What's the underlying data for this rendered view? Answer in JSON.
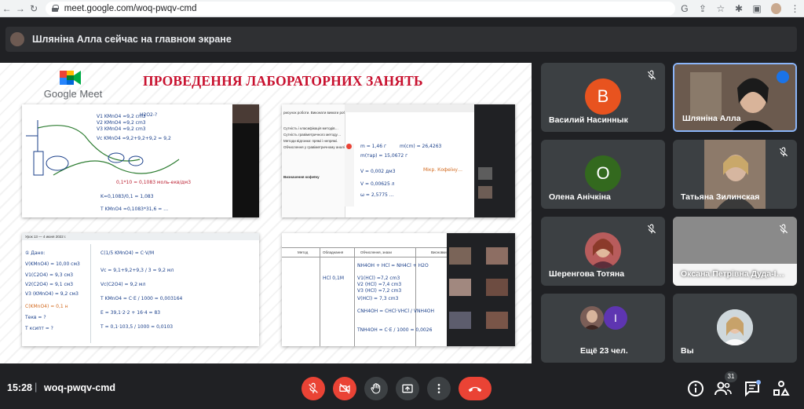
{
  "browser": {
    "url": "meet.google.com/woq-pwqv-cmd"
  },
  "banner": {
    "text": "Шляніна Алла сейчас на главном экране"
  },
  "slide": {
    "logo_text": "Google Meet",
    "title": "ПРОВЕДЕННЯ ЛАБОРАТОРНИХ ЗАНЯТЬ"
  },
  "participants": [
    {
      "name": "Василий Насиннык",
      "initial": "В",
      "color": "#e8531f"
    },
    {
      "name": "Шляніна Алла"
    },
    {
      "name": "Олена Анічкіна",
      "initial": "О",
      "color": "#33691e"
    },
    {
      "name": "Татьяна Зилинская"
    },
    {
      "name": "Шеренгова Тотяна"
    },
    {
      "name": "Оксана Петрівна Дуда-І…"
    },
    {
      "name": "Ещё 23 чел.",
      "initial": "I",
      "color": "#5e35b1"
    },
    {
      "name": "Вы"
    }
  ],
  "meeting": {
    "time": "15:28",
    "separator": "|",
    "code": "woq-pwqv-cmd",
    "participant_count": "31"
  },
  "icons": {
    "mic_off": "mic-off-icon",
    "cam_off": "videocam-off-icon",
    "hand": "raise-hand-icon",
    "present": "present-icon",
    "more": "more-vert-icon",
    "leave": "call-end-icon",
    "info": "info-icon",
    "people": "people-icon",
    "chat": "chat-icon",
    "activities": "activities-icon"
  },
  "colors": {
    "leave_red": "#ea4335",
    "bar_bg": "#202124",
    "tile_bg": "#3c4043",
    "speaking_border": "#8ab4f8"
  }
}
